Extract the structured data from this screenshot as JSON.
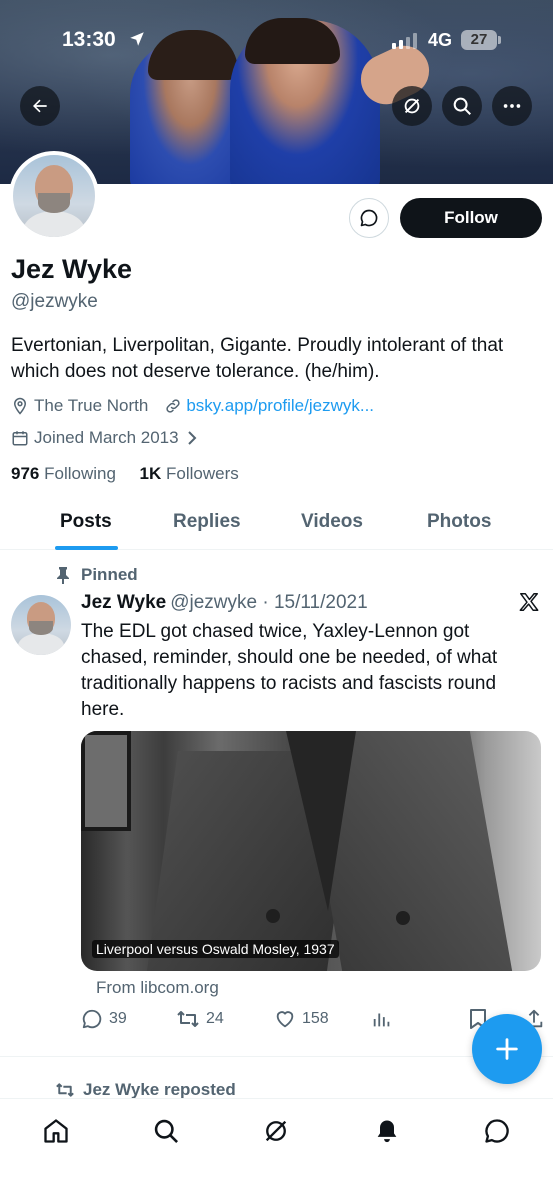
{
  "status_bar": {
    "time": "13:30",
    "network": "4G",
    "battery": "27"
  },
  "header": {
    "back_icon": "arrow-left-icon",
    "grok_icon": "grok-icon",
    "search_icon": "search-icon",
    "more_icon": "more-icon"
  },
  "profile": {
    "name": "Jez Wyke",
    "handle": "@jezwyke",
    "bio": "Evertonian, Liverpolitan, Gigante. Proudly intolerant of that which does not deserve tolerance. (he/him).",
    "location": "The True North",
    "link": "bsky.app/profile/jezwyk...",
    "joined": "Joined March 2013",
    "following_count": "976",
    "following_label": "Following",
    "followers_count": "1K",
    "followers_label": "Followers",
    "follow_button": "Follow"
  },
  "tabs": [
    {
      "label": "Posts",
      "active": true
    },
    {
      "label": "Replies",
      "active": false
    },
    {
      "label": "Videos",
      "active": false
    },
    {
      "label": "Photos",
      "active": false
    }
  ],
  "pinned_post": {
    "pinned_label": "Pinned",
    "author_name": "Jez Wyke",
    "author_handle": "@jezwyke",
    "date": "15/11/2021",
    "text": "The EDL got chased twice, Yaxley-Lennon got chased,  reminder, should one be needed, of what traditionally happens to racists and fascists round here.",
    "image_caption": "Liverpool versus Oswald Mosley, 1937",
    "source": "From libcom.org",
    "replies": "39",
    "reposts": "24",
    "likes": "158"
  },
  "next_post": {
    "reposted_label": "Jez Wyke reposted"
  },
  "bottom_nav": [
    "home-icon",
    "search-icon",
    "grok-icon",
    "notifications-icon",
    "messages-icon"
  ],
  "colors": {
    "accent": "#1d9bf0",
    "text_primary": "#0f1419",
    "text_secondary": "#536471",
    "follow_button": "#0f1419"
  }
}
